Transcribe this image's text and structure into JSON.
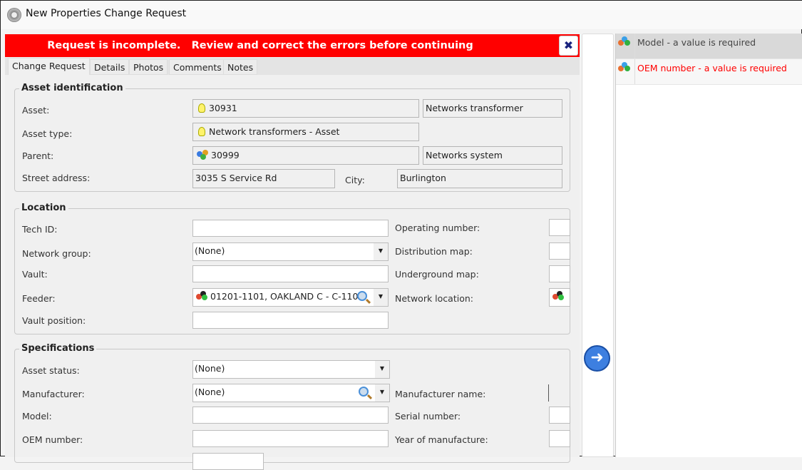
{
  "window": {
    "title": "New Properties Change Request"
  },
  "banner": {
    "message": "Request is incomplete.   Review and correct the errors before continuing",
    "close_label": "✖"
  },
  "tabs": [
    "Change Request",
    "Details",
    "Photos",
    "Comments",
    "Notes"
  ],
  "asset_identification": {
    "title": "Asset identification",
    "asset_label": "Asset:",
    "asset_value": "30931",
    "asset_desc": "Networks transformer",
    "asset_type_label": "Asset type:",
    "asset_type_value": "Network transformers - Asset",
    "parent_label": "Parent:",
    "parent_value": "30999",
    "parent_desc": "Networks system",
    "street_label": "Street address:",
    "street_value": "3035 S Service Rd",
    "city_label": "City:",
    "city_value": "Burlington"
  },
  "location": {
    "title": "Location",
    "tech_id_label": "Tech ID:",
    "tech_id_value": "",
    "network_group_label": "Network group:",
    "network_group_value": "(None)",
    "vault_label": "Vault:",
    "vault_value": "",
    "feeder_label": "Feeder:",
    "feeder_value": "01201-1101, OAKLAND C - C-110",
    "vault_position_label": "Vault position:",
    "vault_position_value": "",
    "operating_number_label": "Operating number:",
    "distribution_map_label": "Distribution map:",
    "underground_map_label": "Underground map:",
    "network_location_label": "Network location:"
  },
  "specifications": {
    "title": "Specifications",
    "asset_status_label": "Asset status:",
    "asset_status_value": "(None)",
    "manufacturer_label": "Manufacturer:",
    "manufacturer_value": "(None)",
    "model_label": "Model:",
    "model_value": "",
    "oem_label": "OEM number:",
    "oem_value": "",
    "manufacturer_name_label": "Manufacturer name:",
    "serial_label": "Serial number:",
    "year_label": "Year of manufacture:"
  },
  "errors": [
    {
      "text": "Model -  a value is required",
      "color": "#444444"
    },
    {
      "text": "OEM number -  a value is required",
      "color": "#ff0000"
    }
  ],
  "next_arrow": "➜"
}
